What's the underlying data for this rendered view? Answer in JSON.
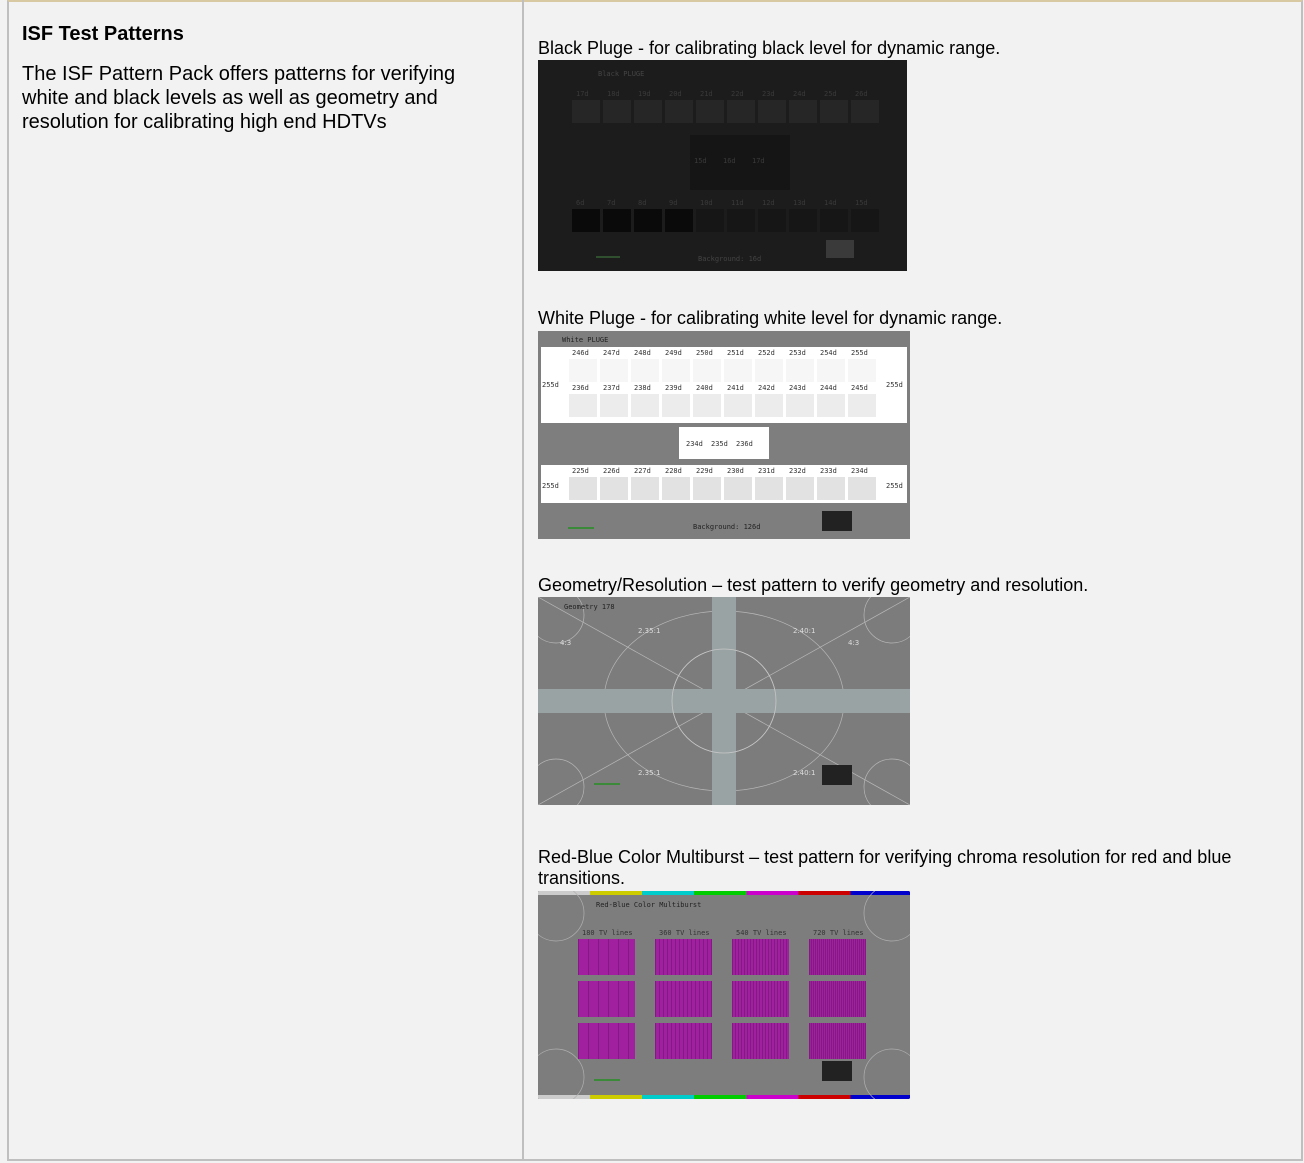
{
  "left": {
    "title": "ISF Test Patterns",
    "description": "The ISF Pattern Pack offers patterns for verifying white and black levels as well as geometry and resolution for calibrating high end HDTVs"
  },
  "patterns": [
    {
      "caption": "Black Pluge - for calibrating black level for dynamic range.",
      "title": "Black PLUGE",
      "top_labels": [
        "17d",
        "18d",
        "19d",
        "20d",
        "21d",
        "22d",
        "23d",
        "24d",
        "25d",
        "26d"
      ],
      "mid_labels": [
        "15d",
        "16d",
        "17d"
      ],
      "bottom_labels": [
        "6d",
        "7d",
        "8d",
        "9d",
        "10d",
        "11d",
        "12d",
        "13d",
        "14d",
        "15d"
      ],
      "background_label": "Background: 16d"
    },
    {
      "caption": "White Pluge - for calibrating white level for dynamic range.",
      "title": "White PLUGE",
      "row1_labels": [
        "246d",
        "247d",
        "248d",
        "249d",
        "250d",
        "251d",
        "252d",
        "253d",
        "254d",
        "255d"
      ],
      "row2_labels": [
        "236d",
        "237d",
        "238d",
        "239d",
        "240d",
        "241d",
        "242d",
        "243d",
        "244d",
        "245d"
      ],
      "mid_labels": [
        "234d",
        "235d",
        "236d"
      ],
      "row3_labels": [
        "225d",
        "226d",
        "227d",
        "228d",
        "229d",
        "230d",
        "231d",
        "232d",
        "233d",
        "234d"
      ],
      "edge_label": "255d",
      "background_label": "Background: 126d"
    },
    {
      "caption": "Geometry/Resolution – test pattern to verify geometry and resolution.",
      "title": "Geometry 178",
      "ratio_labels": [
        "2.35:1",
        "2.40:1",
        "4:3",
        "4:3",
        "2.35:1",
        "2.40:1"
      ]
    },
    {
      "caption": "Red-Blue Color Multiburst – test pattern for verifying chroma resolution for red and blue transitions.",
      "title": "Red-Blue Color Multiburst",
      "column_labels": [
        "180 TV lines",
        "360 TV lines",
        "540 TV lines",
        "720 TV lines"
      ]
    }
  ],
  "colors": {
    "background": "#f2f2f2",
    "border": "#bfbfbf",
    "top_border": "#d9c9a3",
    "magenta": "#a020a0"
  }
}
